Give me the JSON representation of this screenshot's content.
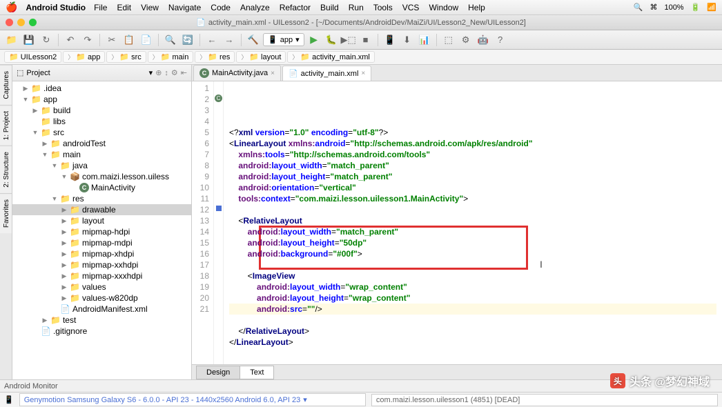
{
  "menubar": {
    "app": "Android Studio",
    "items": [
      "File",
      "Edit",
      "View",
      "Navigate",
      "Code",
      "Analyze",
      "Refactor",
      "Build",
      "Run",
      "Tools",
      "VCS",
      "Window",
      "Help"
    ],
    "battery": "100%"
  },
  "window": {
    "title": "activity_main.xml - UILesson2 - [~/Documents/AndroidDev/MaiZi/UI/Lesson2_New/UILesson2]"
  },
  "toolbar": {
    "run_config": "app"
  },
  "nav": {
    "crumbs": [
      "UILesson2",
      "app",
      "src",
      "main",
      "res",
      "layout",
      "activity_main.xml"
    ]
  },
  "project_panel": {
    "title": "Project",
    "tree": [
      {
        "indent": 1,
        "expander": "▶",
        "icon": "folder",
        "label": ".idea"
      },
      {
        "indent": 1,
        "expander": "▼",
        "icon": "folder",
        "label": "app"
      },
      {
        "indent": 2,
        "expander": "▶",
        "icon": "folder",
        "label": "build"
      },
      {
        "indent": 2,
        "expander": "",
        "icon": "folder",
        "label": "libs"
      },
      {
        "indent": 2,
        "expander": "▼",
        "icon": "folder",
        "label": "src"
      },
      {
        "indent": 3,
        "expander": "▶",
        "icon": "folder",
        "label": "androidTest"
      },
      {
        "indent": 3,
        "expander": "▼",
        "icon": "folder",
        "label": "main"
      },
      {
        "indent": 4,
        "expander": "▼",
        "icon": "folder",
        "label": "java"
      },
      {
        "indent": 5,
        "expander": "▼",
        "icon": "package",
        "label": "com.maizi.lesson.uiless"
      },
      {
        "indent": 6,
        "expander": "",
        "icon": "class",
        "label": "MainActivity"
      },
      {
        "indent": 4,
        "expander": "▼",
        "icon": "res",
        "label": "res"
      },
      {
        "indent": 5,
        "expander": "▶",
        "icon": "res",
        "label": "drawable",
        "selected": true
      },
      {
        "indent": 5,
        "expander": "▶",
        "icon": "res",
        "label": "layout"
      },
      {
        "indent": 5,
        "expander": "▶",
        "icon": "res",
        "label": "mipmap-hdpi"
      },
      {
        "indent": 5,
        "expander": "▶",
        "icon": "res",
        "label": "mipmap-mdpi"
      },
      {
        "indent": 5,
        "expander": "▶",
        "icon": "res",
        "label": "mipmap-xhdpi"
      },
      {
        "indent": 5,
        "expander": "▶",
        "icon": "res",
        "label": "mipmap-xxhdpi"
      },
      {
        "indent": 5,
        "expander": "▶",
        "icon": "res",
        "label": "mipmap-xxxhdpi"
      },
      {
        "indent": 5,
        "expander": "▶",
        "icon": "res",
        "label": "values"
      },
      {
        "indent": 5,
        "expander": "▶",
        "icon": "res",
        "label": "values-w820dp"
      },
      {
        "indent": 4,
        "expander": "",
        "icon": "xml",
        "label": "AndroidManifest.xml"
      },
      {
        "indent": 3,
        "expander": "▶",
        "icon": "folder",
        "label": "test"
      },
      {
        "indent": 2,
        "expander": "",
        "icon": "file",
        "label": ".gitignore"
      }
    ]
  },
  "left_tabs": [
    "Captures",
    "1: Project",
    "2: Structure",
    "Favorites"
  ],
  "editor": {
    "tabs": [
      {
        "icon": "class",
        "label": "MainActivity.java",
        "active": false
      },
      {
        "icon": "xml",
        "label": "activity_main.xml",
        "active": true
      }
    ],
    "bottom_tabs": [
      {
        "label": "Design",
        "active": false
      },
      {
        "label": "Text",
        "active": true
      }
    ],
    "line_count": 21,
    "current_line": 17,
    "markers": {
      "2": "c",
      "12": "blue"
    },
    "code_lines": [
      "<span class='punct'>&lt;?</span><span class='tag'>xml</span> <span class='attr'>version</span><span class='punct'>=</span><span class='val'>\"1.0\"</span> <span class='attr'>encoding</span><span class='punct'>=</span><span class='val'>\"utf-8\"</span><span class='punct'>?&gt;</span>",
      "<span class='punct'>&lt;</span><span class='tag'>LinearLayout</span> <span class='ns'>xmlns:</span><span class='attr'>android</span><span class='punct'>=</span><span class='val'>\"http://schemas.android.com/apk/res/android\"</span>",
      "    <span class='ns'>xmlns:</span><span class='attr'>tools</span><span class='punct'>=</span><span class='val'>\"http://schemas.android.com/tools\"</span>",
      "    <span class='ns'>android:</span><span class='attr'>layout_width</span><span class='punct'>=</span><span class='val'>\"match_parent\"</span>",
      "    <span class='ns'>android:</span><span class='attr'>layout_height</span><span class='punct'>=</span><span class='val'>\"match_parent\"</span>",
      "    <span class='ns'>android:</span><span class='attr'>orientation</span><span class='punct'>=</span><span class='val'>\"vertical\"</span>",
      "    <span class='ns'>tools:</span><span class='attr'>context</span><span class='punct'>=</span><span class='val'>\"com.maizi.lesson.uilesson1.MainActivity\"</span><span class='punct'>&gt;</span>",
      "",
      "    <span class='punct'>&lt;</span><span class='tag'>RelativeLayout</span>",
      "        <span class='ns'>android:</span><span class='attr'>layout_width</span><span class='punct'>=</span><span class='val'>\"match_parent\"</span>",
      "        <span class='ns'>android:</span><span class='attr'>layout_height</span><span class='punct'>=</span><span class='val'>\"50dp\"</span>",
      "        <span class='ns'>android:</span><span class='attr'>background</span><span class='punct'>=</span><span class='val'>\"#00f\"</span><span class='punct'>&gt;</span>",
      "",
      "        <span class='punct'>&lt;</span><span class='tag'>ImageView</span>",
      "            <span class='ns'>android:</span><span class='attr'>layout_width</span><span class='punct'>=</span><span class='val'>\"wrap_content\"</span>",
      "            <span class='ns'>android:</span><span class='attr'>layout_height</span><span class='punct'>=</span><span class='val'>\"wrap_content\"</span>",
      "            <span class='ns'>android:</span><span class='attr'>src</span><span class='punct'>=</span><span class='val'>\"\"</span><span class='punct'>/&gt;</span>",
      "",
      "    <span class='punct'>&lt;/</span><span class='tag'>RelativeLayout</span><span class='punct'>&gt;</span>",
      "<span class='punct'>&lt;/</span><span class='tag'>LinearLayout</span><span class='punct'>&gt;</span>",
      ""
    ]
  },
  "bottom_bar": {
    "label": "Android Monitor"
  },
  "status": {
    "device": "Genymotion Samsung Galaxy S6 - 6.0.0 - API 23 - 1440x2560 Android 6.0, API 23",
    "process": "com.maizi.lesson.uilesson1 (4851) [DEAD]"
  },
  "watermark": "头条 @梦幻神域"
}
